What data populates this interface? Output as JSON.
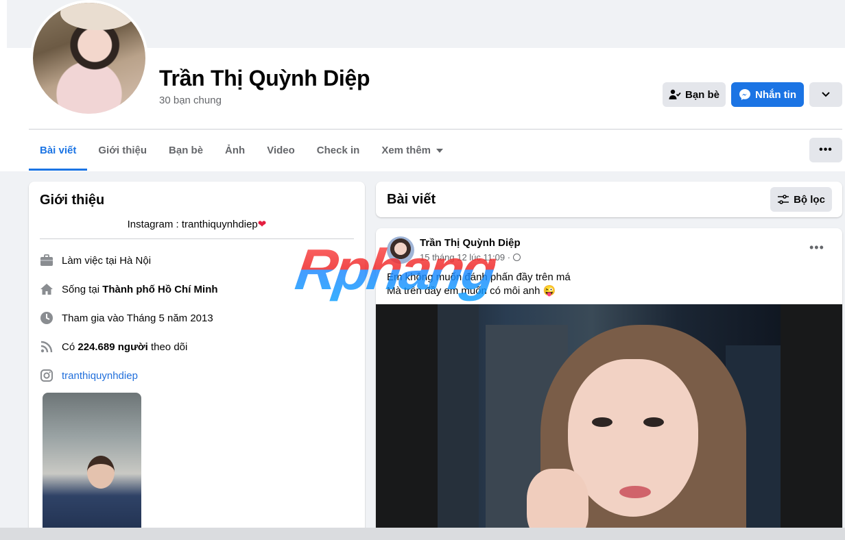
{
  "profile": {
    "name": "Trần Thị Quỳnh Diệp",
    "mutual_friends": "30 bạn chung"
  },
  "actions": {
    "friends_label": "Bạn bè",
    "message_label": "Nhắn tin",
    "accent_color": "#1b74e4"
  },
  "tabs": [
    {
      "label": "Bài viết",
      "active": true
    },
    {
      "label": "Giới thiệu"
    },
    {
      "label": "Bạn bè"
    },
    {
      "label": "Ảnh"
    },
    {
      "label": "Video"
    },
    {
      "label": "Check in"
    },
    {
      "label": "Xem thêm"
    }
  ],
  "intro": {
    "title": "Giới thiệu",
    "bio": "Instagram : tranthiquynhdiep",
    "bio_emoji": "❤️",
    "work": "Làm việc tại Hà Nội",
    "lives_prefix": "Sống tại",
    "lives_city": "Thành phố Hồ Chí Minh",
    "joined": "Tham gia vào Tháng 5 năm 2013",
    "followers_prefix": "Có",
    "followers_count": "224.689 người",
    "followers_suffix": "theo dõi",
    "instagram": "tranthiquynhdiep"
  },
  "posts": {
    "title": "Bài viết",
    "filter_label": "Bộ lọc",
    "post": {
      "author": "Trần Thị Quỳnh Diệp",
      "time": "15 tháng 12 lúc 11:09 ·",
      "line1": "Em không muốn đánh phấn đầy trên má",
      "line2": "Mà trên đầy em muốn có môi anh 😜"
    }
  },
  "watermark": "Rphang"
}
